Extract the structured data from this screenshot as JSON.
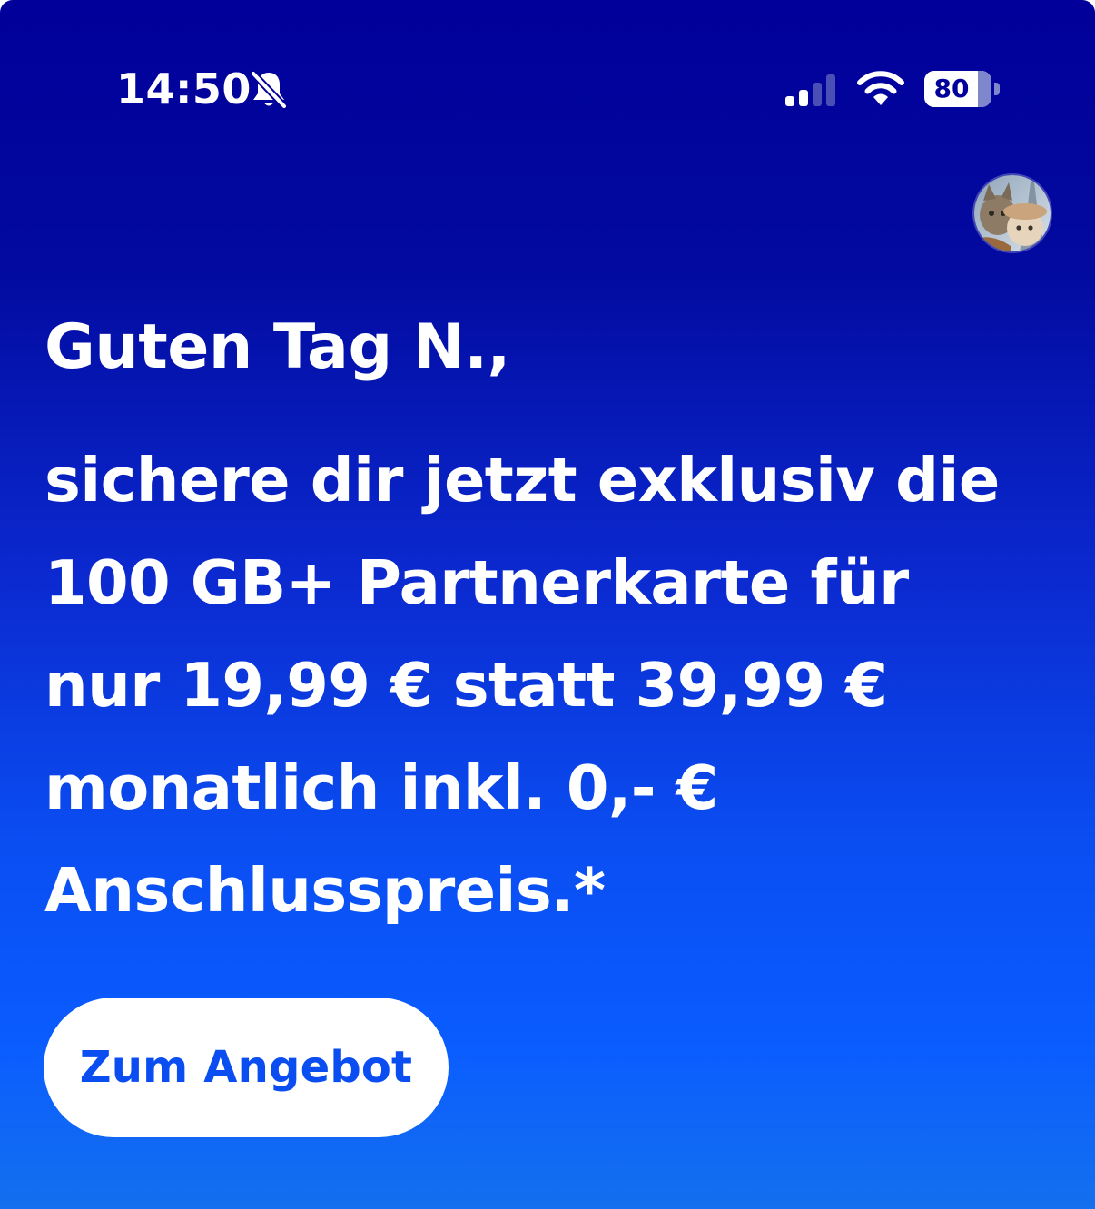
{
  "status_bar": {
    "time": "14:50",
    "silent_icon": "bell-slash-icon",
    "signal_icon": "cellular-signal-icon",
    "signal_bars_active": 2,
    "signal_bars_total": 4,
    "wifi_icon": "wifi-icon",
    "battery_level": "80",
    "battery_fraction": 0.8
  },
  "header": {
    "avatar_icon": "cat-photo-avatar"
  },
  "main": {
    "greeting": "Guten Tag N.,",
    "offer_lines": [
      "sichere dir jetzt exklusiv die",
      "100 GB+ Partnerkarte für",
      "nur 19,99 € statt 39,99 €",
      "monatlich inkl. 0,- €",
      "Anschlusspreis.*"
    ],
    "cta_label": "Zum Angebot"
  },
  "colors": {
    "background_top": "#01009a",
    "background_bottom": "#1470ee",
    "text": "#ffffff",
    "cta_text": "#0a4ef2",
    "cta_background": "#ffffff"
  }
}
